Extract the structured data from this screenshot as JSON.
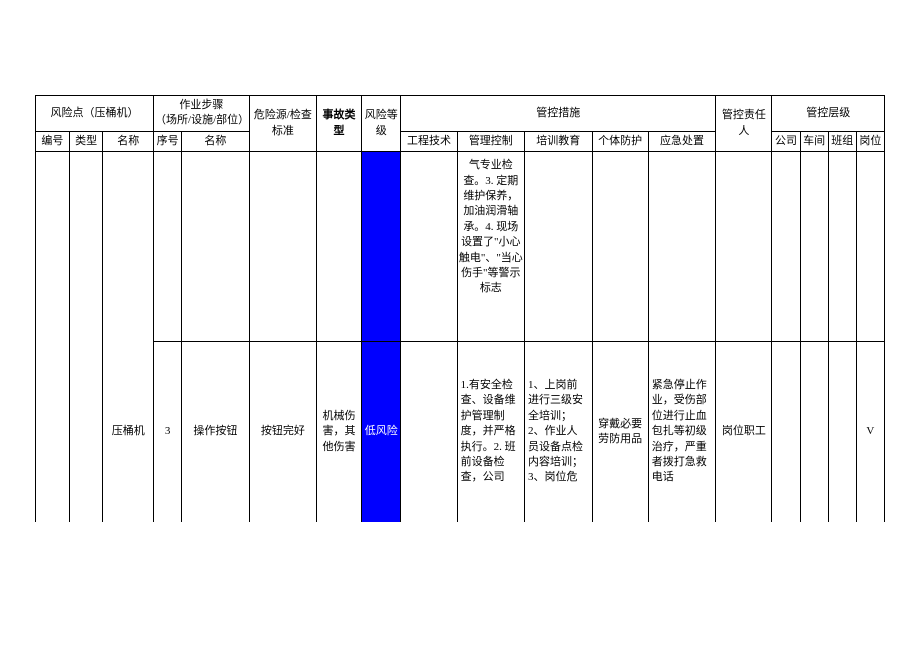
{
  "headers": {
    "risk_point": "风险点（压桶机）",
    "operation_step": "作业步骤\n（场所/设施/部位）",
    "hazard_source": "危险源/检查标准",
    "accident_type": "事故类型",
    "risk_level": "风险等级",
    "control_measures": "管控措施",
    "control_person": "管控责任人",
    "control_level": "管控层级",
    "sub": {
      "number": "编号",
      "type": "类型",
      "name_risk": "名称",
      "seq": "序号",
      "name_op": "名称",
      "engineering": "工程技术",
      "management": "管理控制",
      "training": "培训教育",
      "ppe": "个体防护",
      "emergency": "应急处置",
      "company": "公司",
      "workshop": "车间",
      "team": "班组",
      "post": "岗位"
    }
  },
  "prev_row": {
    "management": "气专业检查。3. 定期维护保养，加油润滑轴承。4. 现场设置了\"小心触电\"、\"当心伤手\"等警示标志"
  },
  "row": {
    "name_risk": "压桶机",
    "seq": "3",
    "name_op": "操作按钮",
    "hazard_source": "按钮完好",
    "accident_type": "机械伤害，其他伤害",
    "risk_level": "低风险",
    "engineering": "",
    "management": "1.有安全检查、设备维护管理制度，并严格执行。2. 班前设备检查，公司",
    "training": "1、上岗前进行三级安全培训；2、作业人员设备点检内容培训；3、岗位危",
    "ppe": "穿戴必要劳防用品",
    "emergency": "紧急停止作业，受伤部位进行止血包扎等初级治疗，严重者拨打急救电话",
    "control_person": "岗位职工",
    "company": "",
    "workshop": "",
    "team": "",
    "post": "V"
  }
}
